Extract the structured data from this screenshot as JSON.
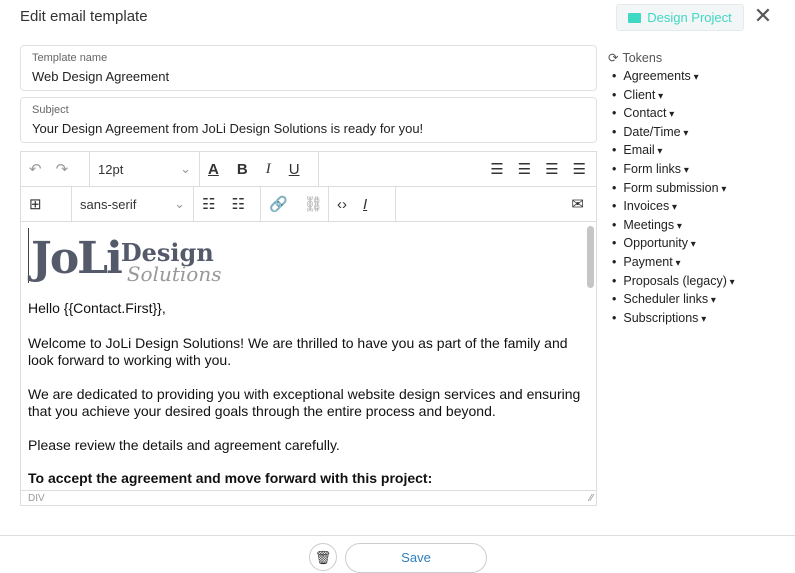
{
  "header": {
    "title": "Edit email template",
    "project_label": "Design Project",
    "close": "✕"
  },
  "template_name": {
    "label": "Template name",
    "value": "Web Design Agreement"
  },
  "subject": {
    "label": "Subject",
    "value": "Your Design Agreement from JoLi Design Solutions is ready for you!"
  },
  "toolbar": {
    "font_size": "12pt",
    "font_family": "sans-serif"
  },
  "content": {
    "logo": {
      "main": "JoLi",
      "design": "Design",
      "solutions": "Solutions"
    },
    "greeting": "Hello {{Contact.First}},",
    "p1": "Welcome to JoLi Design Solutions! We are thrilled to have you as part of the family and look forward to working with you.",
    "p2": "We are dedicated to providing you with exceptional website design services and ensuring that you achieve your desired goals through the entire process and beyond.",
    "p3": "Please review the details and agreement carefully.",
    "p4": "To accept the agreement and move forward with this project:"
  },
  "status_path": "DIV",
  "tokens": {
    "title": "Tokens",
    "items": [
      "Agreements",
      "Client",
      "Contact",
      "Date/Time",
      "Email",
      "Form links",
      "Form submission",
      "Invoices",
      "Meetings",
      "Opportunity",
      "Payment",
      "Proposals (legacy)",
      "Scheduler links",
      "Subscriptions"
    ]
  },
  "footer": {
    "save_label": "Save"
  },
  "colors": {
    "accent": "#3fd8c3",
    "save_text": "#2e7fc0"
  }
}
